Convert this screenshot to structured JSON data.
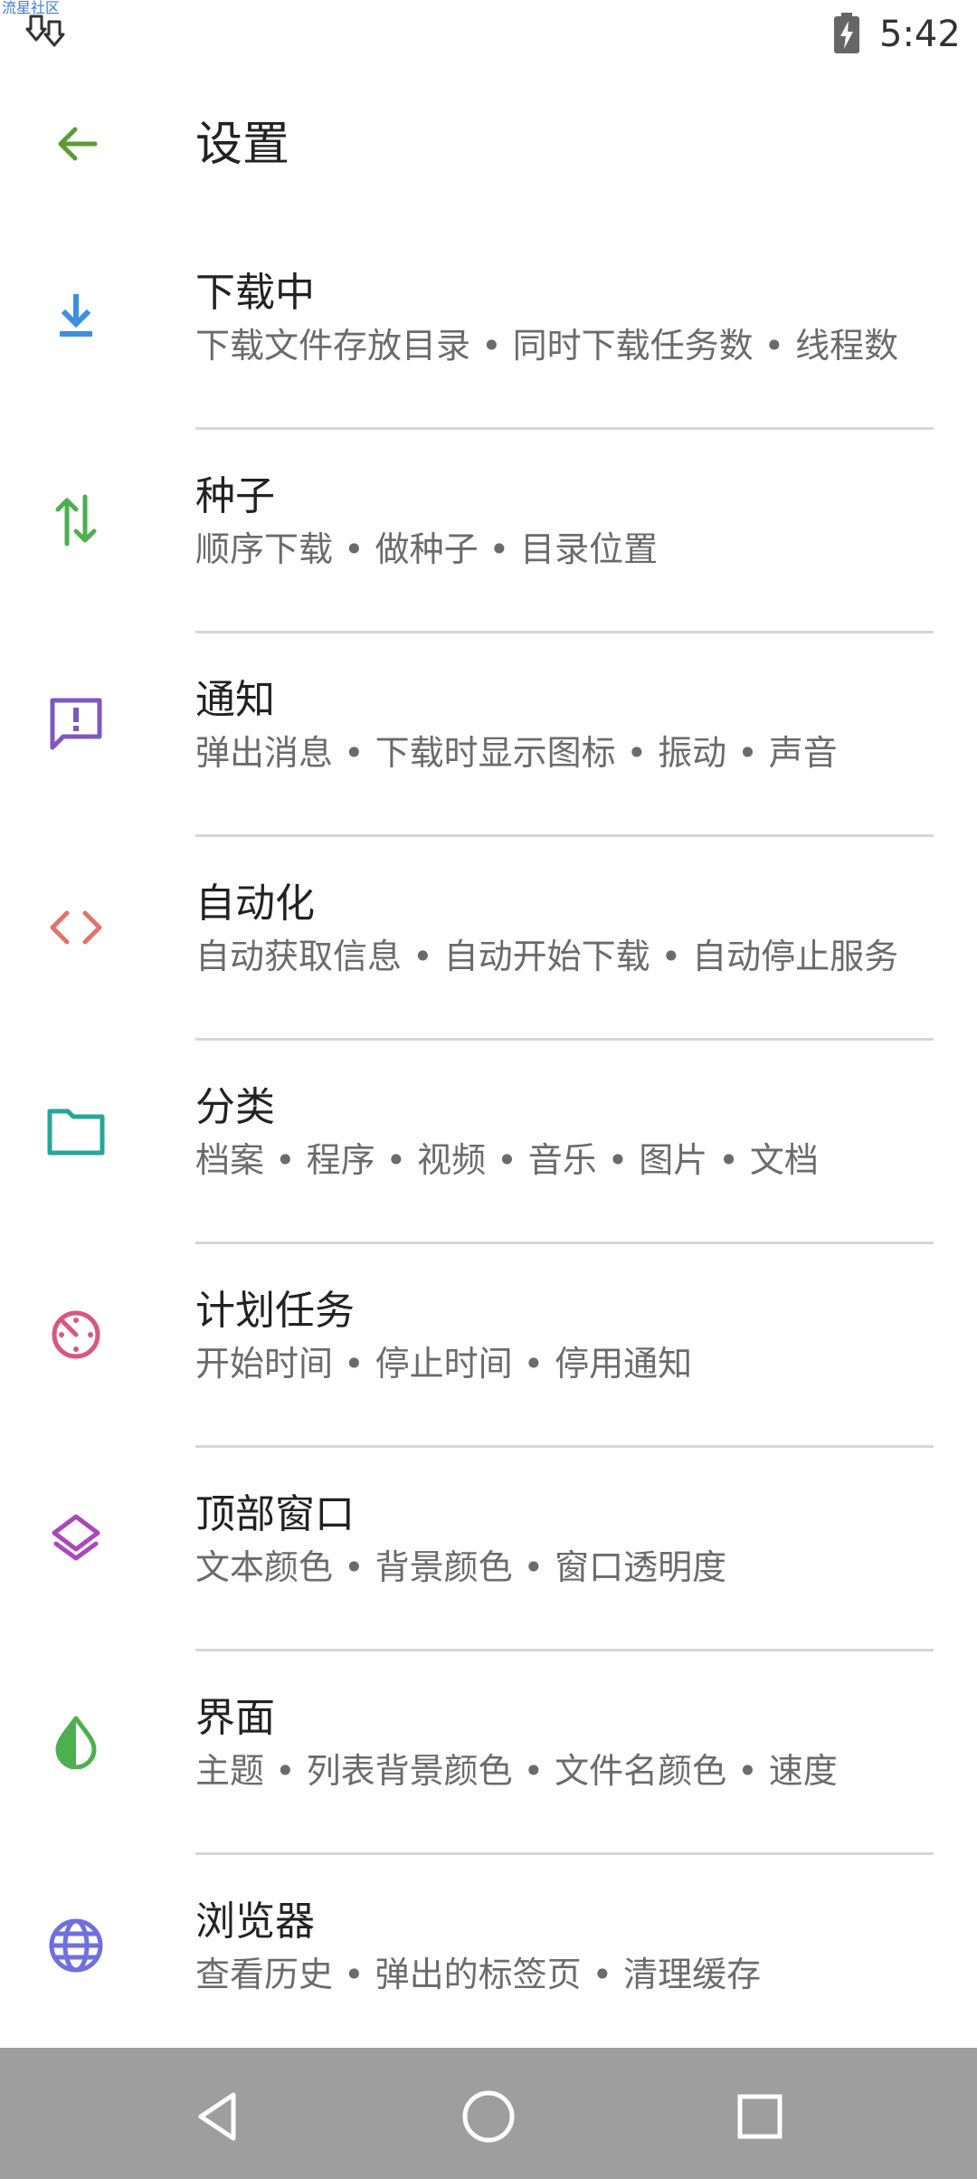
{
  "status_bar": {
    "watermark": "流星社区",
    "time": "5:42",
    "download_indicator_icon": "double-download-arrow-icon",
    "battery_icon": "battery-charging-icon"
  },
  "app_bar": {
    "back_icon": "arrow-left-icon",
    "title": "设置",
    "accent_color": "#4caf50"
  },
  "settings": {
    "items": [
      {
        "title": "下载中",
        "subtitle": "下载文件存放目录 • 同时下载任务数 • 线程数",
        "icon": "download-icon",
        "icon_color": "#3d8fe0"
      },
      {
        "title": "种子",
        "subtitle": "顺序下载 • 做种子 • 目录位置",
        "icon": "up-down-arrows-icon",
        "icon_color": "#4caf50"
      },
      {
        "title": "通知",
        "subtitle": "弹出消息 • 下载时显示图标 • 振动 • 声音",
        "icon": "message-alert-icon",
        "icon_color": "#7e57c2"
      },
      {
        "title": "自动化",
        "subtitle": "自动获取信息 • 自动开始下载 • 自动停止服务",
        "icon": "code-brackets-icon",
        "icon_color": "#e57368"
      },
      {
        "title": "分类",
        "subtitle": "档案 • 程序 • 视频 • 音乐 • 图片 • 文档",
        "icon": "folder-icon",
        "icon_color": "#26a69a"
      },
      {
        "title": "计划任务",
        "subtitle": "开始时间 • 停止时间 • 停用通知",
        "icon": "timer-icon",
        "icon_color": "#d9577e"
      },
      {
        "title": "顶部窗口",
        "subtitle": "文本颜色 • 背景颜色 • 窗口透明度",
        "icon": "layers-icon",
        "icon_color": "#ab47bc"
      },
      {
        "title": "界面",
        "subtitle": "主题 • 列表背景颜色 • 文件名颜色 • 速度",
        "icon": "contrast-drop-icon",
        "icon_color": "#4caf50"
      },
      {
        "title": "浏览器",
        "subtitle": "查看历史 • 弹出的标签页 • 清理缓存",
        "icon": "globe-icon",
        "icon_color": "#6f6fe0"
      }
    ]
  },
  "nav_bar": {
    "back_icon": "nav-back-triangle-icon",
    "home_icon": "nav-home-circle-icon",
    "recents_icon": "nav-recents-square-icon",
    "background": "#9e9e9e"
  }
}
